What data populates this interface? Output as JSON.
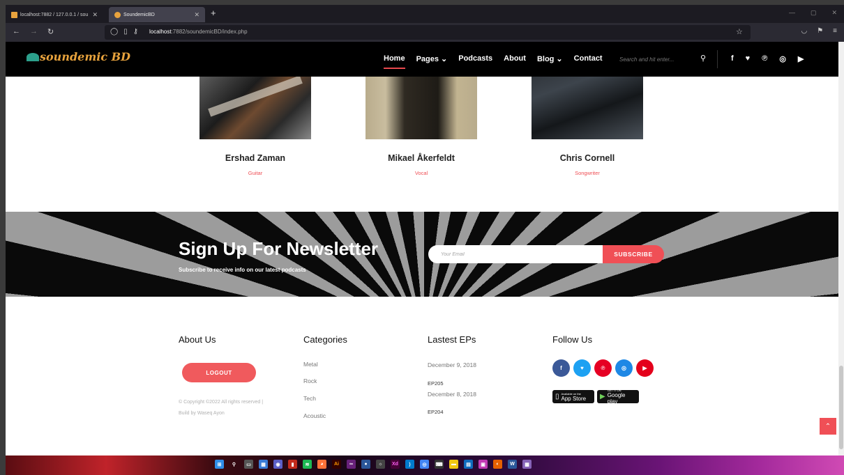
{
  "browser": {
    "tabs": [
      {
        "label": "localhost:7882 / 127.0.0.1 / sou"
      },
      {
        "label": "SoundemicBD"
      }
    ],
    "url_prefix": "localhost",
    "url_path": ":7882/soundemicBD/index.php"
  },
  "site": {
    "logo_text": "soundemic BD",
    "menu": [
      {
        "label": "Home"
      },
      {
        "label": "Pages ⌄"
      },
      {
        "label": "Podcasts"
      },
      {
        "label": "About"
      },
      {
        "label": "Blog ⌄"
      },
      {
        "label": "Contact"
      }
    ],
    "search_placeholder": "Search and hit enter..."
  },
  "team": [
    {
      "name": "Ershad Zaman",
      "role": "Guitar"
    },
    {
      "name": "Mikael Åkerfeldt",
      "role": "Vocal"
    },
    {
      "name": "Chris Cornell",
      "role": "Songwriter"
    }
  ],
  "newsletter": {
    "title": "Sign Up For Newsletter",
    "subtitle": "Subscribe to receive info on our latest podcasts",
    "email_placeholder": "Your Email",
    "button": "SUBSCRIBE"
  },
  "footer": {
    "about": {
      "title": "About Us",
      "logout": "LOGOUT",
      "copyright_line1": "© Copyright ©2022 All rights reserved |",
      "copyright_line2": "Build by Waseq Ayon"
    },
    "categories": {
      "title": "Categories",
      "items": [
        "Metal",
        "Rock",
        "Tech",
        "Acoustic"
      ]
    },
    "episodes": {
      "title": "Lastest EPs",
      "items": [
        {
          "date": "December 9, 2018",
          "code": "EP205"
        },
        {
          "date": "December 8, 2018",
          "code": "EP204"
        }
      ]
    },
    "follow": {
      "title": "Follow Us",
      "app_store_small": "Available on the",
      "app_store_big": "App Store",
      "google_play_small": "GET IT ON",
      "google_play_big": "Google play"
    }
  },
  "colors": {
    "accent": "#f04f56",
    "header_bg": "#000000"
  }
}
